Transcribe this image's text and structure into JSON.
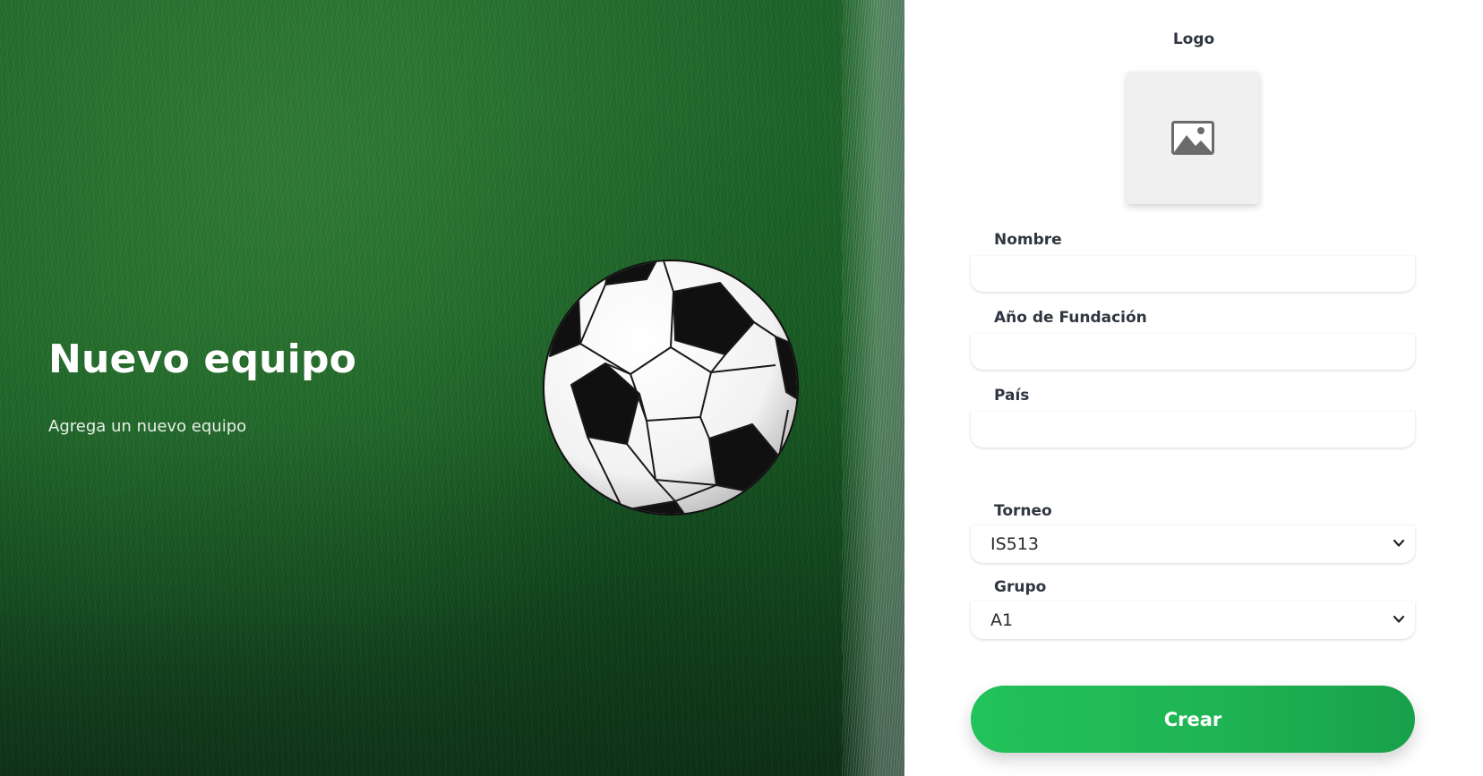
{
  "hero": {
    "title": "Nuevo equipo",
    "subtitle": "Agrega un nuevo equipo",
    "background_color": "#1d6a2a"
  },
  "form": {
    "logo": {
      "label": "Logo",
      "icon": "image-placeholder-icon"
    },
    "fields": {
      "name": {
        "label": "Nombre",
        "value": ""
      },
      "founded": {
        "label": "Año de Fundación",
        "value": ""
      },
      "country": {
        "label": "País",
        "value": ""
      }
    },
    "selects": {
      "tournament": {
        "label": "Torneo",
        "value": "IS513",
        "icon": "chevron-down-icon"
      },
      "group": {
        "label": "Grupo",
        "value": "A1",
        "icon": "chevron-down-icon"
      }
    },
    "submit": {
      "label": "Crear",
      "color": "#1fb454"
    }
  }
}
